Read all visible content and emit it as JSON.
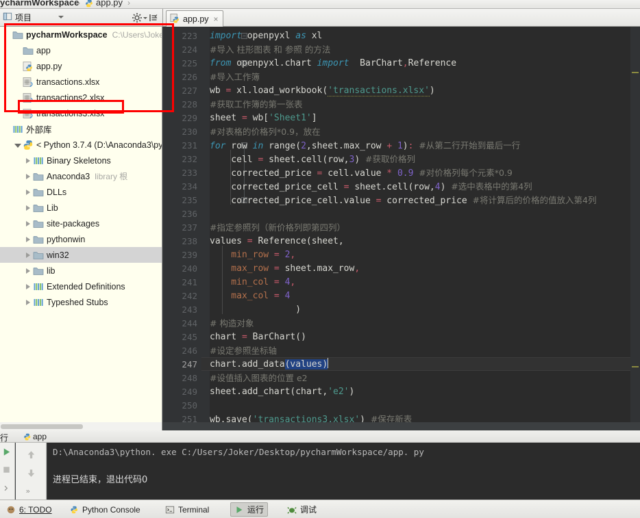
{
  "window": {
    "breadcrumb_project": "ycharmWorkspace",
    "breadcrumb_file": "app.py",
    "breadcrumb_sep": "›"
  },
  "toolbar": {
    "project_label": "项目",
    "gear_icon": "gear-icon",
    "collapse_icon": "collapse-all-icon",
    "tab": {
      "name": "app.py",
      "close": "×",
      "icon": "python-file-icon"
    }
  },
  "project_tree": {
    "items": [
      {
        "indent": 0,
        "twisty": "none",
        "icon": "folder-icon",
        "label": "pycharmWorkspace",
        "bold": true,
        "path": "C:\\Users\\Joker",
        "selected": false
      },
      {
        "indent": 1,
        "twisty": "none",
        "icon": "folder-icon",
        "label": "app",
        "bold": false,
        "path": "",
        "selected": false
      },
      {
        "indent": 1,
        "twisty": "none",
        "icon": "python-file-icon",
        "label": "app.py",
        "bold": false,
        "path": "",
        "selected": false
      },
      {
        "indent": 1,
        "twisty": "none",
        "icon": "xlsx-file-icon",
        "label": "transactions.xlsx",
        "bold": false,
        "path": "",
        "selected": false
      },
      {
        "indent": 1,
        "twisty": "none",
        "icon": "xlsx-file-icon",
        "label": "transactions2.xlsx",
        "bold": false,
        "path": "",
        "selected": false
      },
      {
        "indent": 1,
        "twisty": "none",
        "icon": "xlsx-file-icon",
        "label": "transactions3.xlsx",
        "bold": false,
        "path": "",
        "selected": false
      },
      {
        "indent": 0,
        "twisty": "none",
        "icon": "library-icon",
        "label": "外部库",
        "bold": false,
        "path": "",
        "selected": false
      },
      {
        "indent": 1,
        "twisty": "down",
        "icon": "python-sdk-icon",
        "label": "< Python 3.7.4 (D:\\Anaconda3\\py",
        "bold": false,
        "path": "",
        "selected": false
      },
      {
        "indent": 2,
        "twisty": "right",
        "icon": "library-icon",
        "label": "Binary Skeletons",
        "bold": false,
        "path": "",
        "selected": false
      },
      {
        "indent": 2,
        "twisty": "right",
        "icon": "folder-icon",
        "label": "Anaconda3",
        "bold": false,
        "path": "library 根",
        "selected": false
      },
      {
        "indent": 2,
        "twisty": "right",
        "icon": "folder-icon",
        "label": "DLLs",
        "bold": false,
        "path": "",
        "selected": false
      },
      {
        "indent": 2,
        "twisty": "right",
        "icon": "folder-icon",
        "label": "Lib",
        "bold": false,
        "path": "",
        "selected": false
      },
      {
        "indent": 2,
        "twisty": "right",
        "icon": "folder-icon",
        "label": "site-packages",
        "bold": false,
        "path": "",
        "selected": false
      },
      {
        "indent": 2,
        "twisty": "right",
        "icon": "folder-icon",
        "label": "pythonwin",
        "bold": false,
        "path": "",
        "selected": false
      },
      {
        "indent": 2,
        "twisty": "right",
        "icon": "folder-icon",
        "label": "win32",
        "bold": false,
        "path": "",
        "selected": true
      },
      {
        "indent": 2,
        "twisty": "right",
        "icon": "folder-icon",
        "label": "lib",
        "bold": false,
        "path": "",
        "selected": false
      },
      {
        "indent": 2,
        "twisty": "right",
        "icon": "library-icon",
        "label": "Extended Definitions",
        "bold": false,
        "path": "",
        "selected": false
      },
      {
        "indent": 2,
        "twisty": "right",
        "icon": "library-icon",
        "label": "Typeshed Stubs",
        "bold": false,
        "path": "",
        "selected": false
      }
    ]
  },
  "editor": {
    "first_line_number": 223,
    "current_line_number": 247,
    "lines": [
      {
        "n": 223,
        "tokens": [
          {
            "t": "import",
            "c": "kw"
          },
          {
            "t": " openpyxl ",
            "c": "id"
          },
          {
            "t": "as",
            "c": "kw"
          },
          {
            "t": " xl",
            "c": "id"
          }
        ]
      },
      {
        "n": 224,
        "tokens": [
          {
            "t": "#导入 柱形图表 和 参照 的方法",
            "c": "cmt"
          }
        ]
      },
      {
        "n": 225,
        "tokens": [
          {
            "t": "from",
            "c": "kw"
          },
          {
            "t": " openpyxl.chart ",
            "c": "id"
          },
          {
            "t": "import",
            "c": "kw"
          },
          {
            "t": "  BarChart",
            "c": "id"
          },
          {
            "t": ",",
            "c": "op"
          },
          {
            "t": "Reference",
            "c": "id"
          }
        ]
      },
      {
        "n": 226,
        "tokens": [
          {
            "t": "#导入工作簿",
            "c": "cmt"
          }
        ]
      },
      {
        "n": 227,
        "tokens": [
          {
            "t": "wb ",
            "c": "id"
          },
          {
            "t": "=",
            "c": "op"
          },
          {
            "t": " xl.load_workbook(",
            "c": "id"
          },
          {
            "t": "'transactions.xlsx'",
            "c": "str wavy"
          },
          {
            "t": ")",
            "c": "id"
          }
        ]
      },
      {
        "n": 228,
        "tokens": [
          {
            "t": "#获取工作簿的第一张表",
            "c": "cmt"
          }
        ]
      },
      {
        "n": 229,
        "tokens": [
          {
            "t": "sheet ",
            "c": "id"
          },
          {
            "t": "=",
            "c": "op"
          },
          {
            "t": " wb[",
            "c": "id"
          },
          {
            "t": "'Sheet1'",
            "c": "str"
          },
          {
            "t": "]",
            "c": "id"
          }
        ]
      },
      {
        "n": 230,
        "tokens": [
          {
            "t": "#对表格的价格列*0.9，放在",
            "c": "cmt"
          }
        ]
      },
      {
        "n": 231,
        "tokens": [
          {
            "t": "for",
            "c": "kw"
          },
          {
            "t": " row ",
            "c": "id"
          },
          {
            "t": "in",
            "c": "kw"
          },
          {
            "t": " range(",
            "c": "id"
          },
          {
            "t": "2",
            "c": "num"
          },
          {
            "t": ",sheet.max_row ",
            "c": "id"
          },
          {
            "t": "+",
            "c": "op"
          },
          {
            "t": " ",
            "c": "id"
          },
          {
            "t": "1",
            "c": "num"
          },
          {
            "t": ")",
            "c": "id"
          },
          {
            "t": ":",
            "c": "op"
          },
          {
            "t": " ",
            "c": "id"
          },
          {
            "t": "#从第二行开始到最后一行",
            "c": "cmt"
          }
        ]
      },
      {
        "n": 232,
        "tokens": [
          {
            "t": "    cell ",
            "c": "id"
          },
          {
            "t": "=",
            "c": "op"
          },
          {
            "t": " sheet.cell(row,",
            "c": "id"
          },
          {
            "t": "3",
            "c": "num"
          },
          {
            "t": ") ",
            "c": "id"
          },
          {
            "t": "#获取价格列",
            "c": "cmt"
          }
        ]
      },
      {
        "n": 233,
        "tokens": [
          {
            "t": "    corrected_price ",
            "c": "id"
          },
          {
            "t": "=",
            "c": "op"
          },
          {
            "t": " cell.value ",
            "c": "id"
          },
          {
            "t": "*",
            "c": "op"
          },
          {
            "t": " ",
            "c": "id"
          },
          {
            "t": "0.9",
            "c": "num"
          },
          {
            "t": " ",
            "c": "id"
          },
          {
            "t": "#对价格列每个元素*0.9",
            "c": "cmt"
          }
        ]
      },
      {
        "n": 234,
        "tokens": [
          {
            "t": "    corrected_price_cell ",
            "c": "id"
          },
          {
            "t": "=",
            "c": "op"
          },
          {
            "t": " sheet.cell(row,",
            "c": "id"
          },
          {
            "t": "4",
            "c": "num"
          },
          {
            "t": ") ",
            "c": "id"
          },
          {
            "t": "#选中表格中的第4列",
            "c": "cmt"
          }
        ]
      },
      {
        "n": 235,
        "tokens": [
          {
            "t": "    corrected_price_cell.value ",
            "c": "id"
          },
          {
            "t": "=",
            "c": "op"
          },
          {
            "t": " corrected_price ",
            "c": "id"
          },
          {
            "t": "#将计算后的价格的值放入第4列",
            "c": "cmt"
          }
        ]
      },
      {
        "n": 236,
        "tokens": []
      },
      {
        "n": 237,
        "tokens": [
          {
            "t": "#指定参照列（新价格列即第四列）",
            "c": "cmt"
          }
        ]
      },
      {
        "n": 238,
        "tokens": [
          {
            "t": "values ",
            "c": "id"
          },
          {
            "t": "=",
            "c": "op"
          },
          {
            "t": " Reference(sheet,",
            "c": "id"
          }
        ]
      },
      {
        "n": 239,
        "tokens": [
          {
            "t": "    min_row ",
            "c": "kwarg"
          },
          {
            "t": "=",
            "c": "op"
          },
          {
            "t": " ",
            "c": "id"
          },
          {
            "t": "2",
            "c": "num"
          },
          {
            "t": ",",
            "c": "op"
          }
        ]
      },
      {
        "n": 240,
        "tokens": [
          {
            "t": "    max_row ",
            "c": "kwarg"
          },
          {
            "t": "=",
            "c": "op"
          },
          {
            "t": " sheet.max_row",
            "c": "id"
          },
          {
            "t": ",",
            "c": "op"
          }
        ]
      },
      {
        "n": 241,
        "tokens": [
          {
            "t": "    min_col ",
            "c": "kwarg"
          },
          {
            "t": "=",
            "c": "op"
          },
          {
            "t": " ",
            "c": "id"
          },
          {
            "t": "4",
            "c": "num"
          },
          {
            "t": ",",
            "c": "op"
          }
        ]
      },
      {
        "n": 242,
        "tokens": [
          {
            "t": "    max_col ",
            "c": "kwarg"
          },
          {
            "t": "=",
            "c": "op"
          },
          {
            "t": " ",
            "c": "id"
          },
          {
            "t": "4",
            "c": "num"
          }
        ]
      },
      {
        "n": 243,
        "tokens": [
          {
            "t": "                )",
            "c": "id"
          }
        ]
      },
      {
        "n": 244,
        "tokens": [
          {
            "t": "# 构造对象",
            "c": "cmt"
          }
        ]
      },
      {
        "n": 245,
        "tokens": [
          {
            "t": "chart ",
            "c": "id"
          },
          {
            "t": "=",
            "c": "op"
          },
          {
            "t": " BarChart()",
            "c": "id"
          }
        ]
      },
      {
        "n": 246,
        "tokens": [
          {
            "t": "#设定参照坐标轴",
            "c": "cmt"
          }
        ]
      },
      {
        "n": 247,
        "tokens": [
          {
            "t": "chart.add_data",
            "c": "id"
          },
          {
            "t": "(values)",
            "c": "id sel"
          }
        ]
      },
      {
        "n": 248,
        "tokens": [
          {
            "t": "#设值插入图表的位置 e2",
            "c": "cmt"
          }
        ]
      },
      {
        "n": 249,
        "tokens": [
          {
            "t": "sheet.add_chart(chart,",
            "c": "id"
          },
          {
            "t": "'e2'",
            "c": "str"
          },
          {
            "t": ")",
            "c": "id"
          }
        ]
      },
      {
        "n": 250,
        "tokens": []
      },
      {
        "n": 251,
        "tokens": [
          {
            "t": "wb.save(",
            "c": "id"
          },
          {
            "t": "'transactions3.xlsx'",
            "c": "str wavy"
          },
          {
            "t": ") ",
            "c": "id"
          },
          {
            "t": "#保存新表",
            "c": "cmt"
          }
        ]
      }
    ]
  },
  "run_panel": {
    "header_label": "行",
    "tab_name": "app",
    "tab_icon": "python-config-icon",
    "console_command": "D:\\Anaconda3\\python. exe C:/Users/Joker/Desktop/pycharmWorkspace/app. py",
    "console_result": "进程已结束，退出代码0",
    "side_icons": [
      "run-icon",
      "stop-icon",
      "expand-icon",
      "scroll-up-icon",
      "scroll-down-icon",
      "soft-wrap-icon"
    ]
  },
  "bottom_tabs": [
    {
      "label": "6: TODO",
      "icon": "todo-icon",
      "active": false,
      "mnemonic": "6"
    },
    {
      "label": "Python Console",
      "icon": "python-console-icon",
      "active": false,
      "mnemonic": ""
    },
    {
      "label": "Terminal",
      "icon": "terminal-icon",
      "active": false,
      "mnemonic": ""
    },
    {
      "label": "运行",
      "icon": "run-icon",
      "active": true,
      "mnemonic": ""
    },
    {
      "label": "调试",
      "icon": "debug-icon",
      "active": false,
      "mnemonic": ""
    }
  ],
  "annotations": {
    "box_color": "#FE0000",
    "boxes": [
      "project-files-highlight",
      "transactions3-file-highlight"
    ]
  },
  "colors": {
    "editor_bg": "#2B2B2B",
    "gutter_bg": "#313335",
    "panel_bg": "#FFFFEE",
    "keyword": "#3C96B4",
    "string": "#4E9A8E",
    "number": "#7E62C8",
    "comment": "#7A7A72",
    "kwarg": "#B5714C",
    "operator": "#C75A6A",
    "selection": "#214283",
    "accent_red": "#FE0000"
  }
}
